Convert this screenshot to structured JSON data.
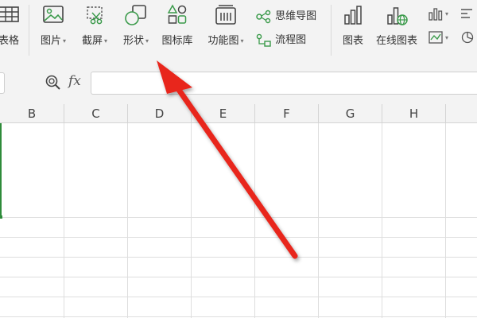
{
  "ribbon": {
    "table_label": "表格",
    "picture_label": "图片",
    "screenshot_label": "截屏",
    "shapes_label": "形状",
    "icon_library_label": "图标库",
    "function_chart_label": "功能图",
    "mind_map_label": "思维导图",
    "flowchart_label": "流程图",
    "chart_label": "图表",
    "online_chart_label": "在线图表"
  },
  "formula_bar": {
    "fx_label": "fx",
    "value": ""
  },
  "sheet": {
    "columns": [
      "B",
      "C",
      "D",
      "E",
      "F",
      "G",
      "H"
    ]
  },
  "annotation": {
    "arrow_color": "#e8261f"
  },
  "colors": {
    "accent_green": "#2e8b3a",
    "toolbar_bg": "#f3f3f3"
  }
}
